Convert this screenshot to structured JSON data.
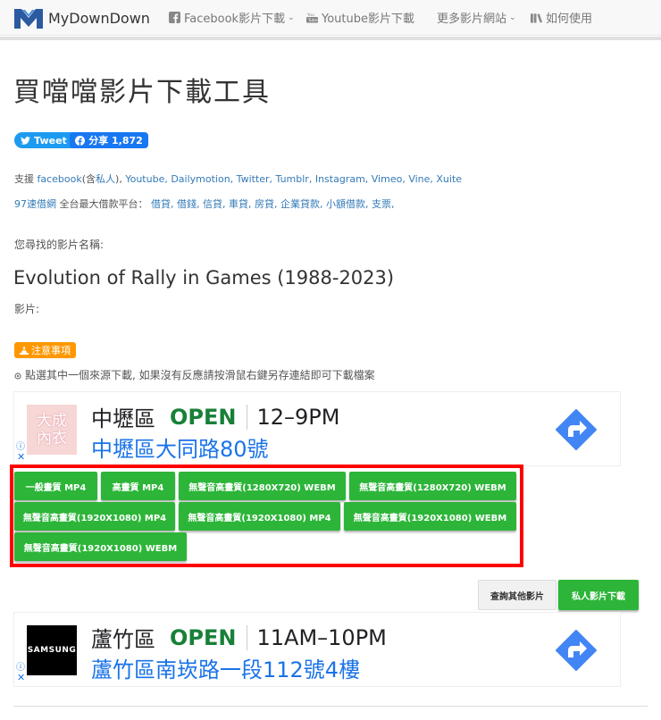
{
  "nav": {
    "brand": "MyDownDown",
    "items": [
      {
        "label": "Facebook影片下載",
        "icon": "facebook-icon",
        "has_caret": true
      },
      {
        "label": "Youtube影片下載",
        "icon": "youtube-icon",
        "has_caret": false
      },
      {
        "label": "更多影片網站",
        "icon": "",
        "has_caret": true
      },
      {
        "label": "如何使用",
        "icon": "library-icon",
        "has_caret": false
      }
    ],
    "caret": "⌄"
  },
  "page": {
    "title": "買噹噹影片下載工具"
  },
  "social": {
    "tweet_label": "Tweet",
    "share_label": "分享 1,872"
  },
  "support": {
    "prefix": "支援 ",
    "facebook": "facebook",
    "paren_open": "(含",
    "private": "私人",
    "paren_close": "), ",
    "sites": "Youtube, Dailymotion, Twitter, Tumblr, Instagram, Vimeo, Vine, Xuite"
  },
  "loan": {
    "site": "97速借網",
    "text": " 全台最大借款平台： ",
    "links": "借貸, 借錢, 信貸, 車貸, 房貸, 企業貸款, 小額借款, 支票,"
  },
  "video": {
    "search_label": "您尋找的影片名稱:",
    "title": "Evolution of Rally in Games (1988-2023)",
    "video_label": "影片:"
  },
  "notice": {
    "badge": "注意事項",
    "instruction": "點選其中一個來源下載, 如果沒有反應請按滑鼠右鍵另存連結即可下載檔案"
  },
  "ads": [
    {
      "logo_text": "大成\n內衣",
      "district": "中壢區",
      "status": "OPEN",
      "hours": "12–9PM",
      "address": "中壢區大同路80號"
    },
    {
      "logo_text": "SAMSUNG",
      "district": "蘆竹區",
      "status": "OPEN",
      "hours": "11AM–10PM",
      "address": "蘆竹區南崁路一段112號4樓"
    }
  ],
  "ad_info": "ⓘ",
  "ad_close": "✕",
  "downloads": [
    "一般畫質 MP4",
    "高畫質 MP4",
    "無聲音高畫質(1280X720) WEBM",
    "無聲音高畫質(1280X720) WEBM",
    "無聲音高畫質(1920X1080) MP4",
    "無聲音高畫質(1920X1080) MP4",
    "無聲音高畫質(1920X1080) WEBM",
    "無聲音高畫質(1920X1080) WEBM"
  ],
  "actions": {
    "query_other": "查詢其他影片",
    "private_download": "私人影片下載"
  },
  "colors": {
    "green": "#2db539",
    "highlight": "#ff0000",
    "link": "#337ab7",
    "notice": "#ff9800"
  }
}
